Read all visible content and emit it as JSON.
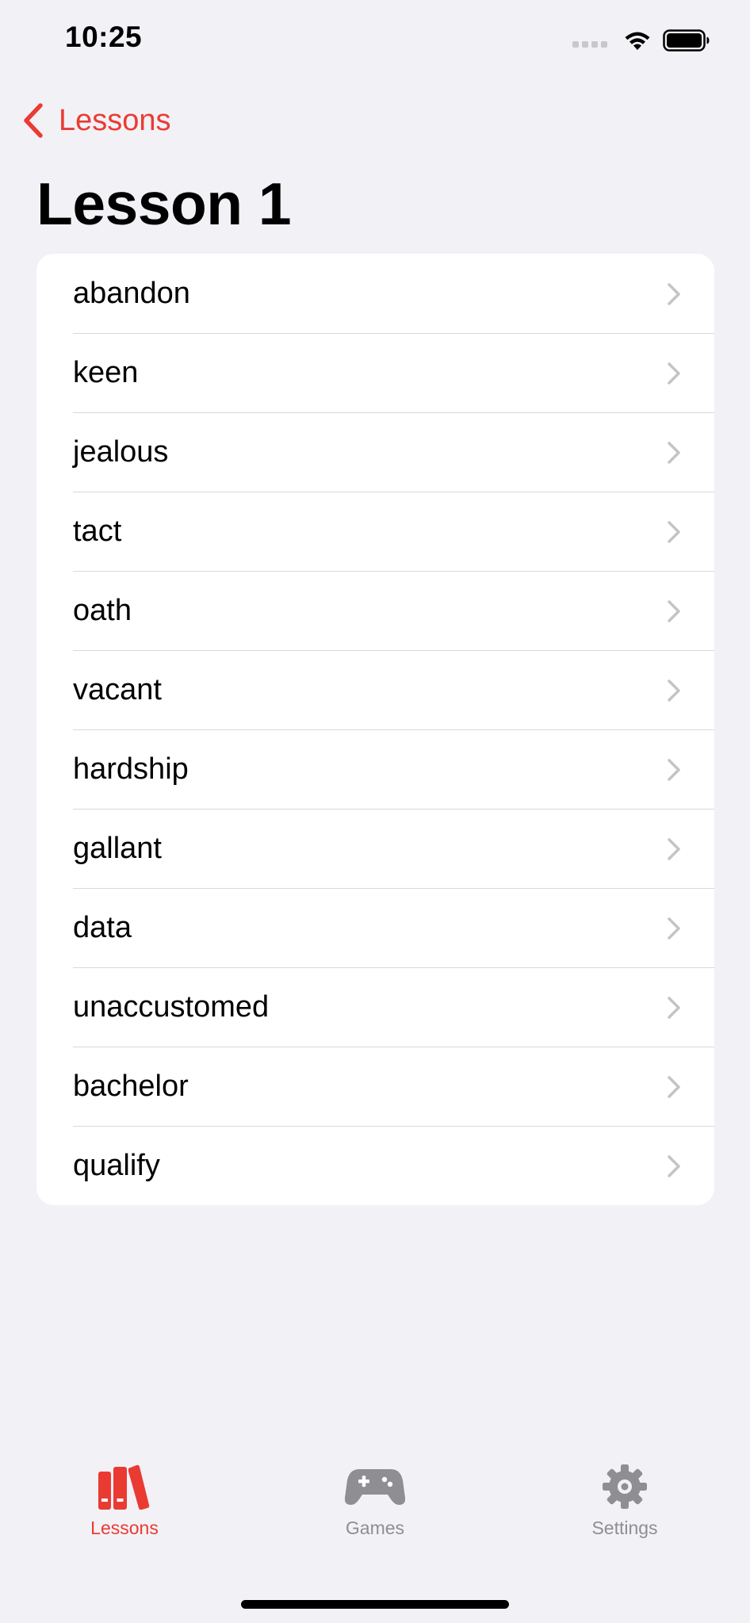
{
  "status_bar": {
    "time": "10:25",
    "signal_icon": "cellular-signal-icon",
    "wifi_icon": "wifi-icon",
    "battery_icon": "battery-full-icon"
  },
  "nav": {
    "back_label": "Lessons",
    "back_icon": "chevron-left-icon"
  },
  "page": {
    "title": "Lesson 1"
  },
  "words": [
    {
      "label": "abandon"
    },
    {
      "label": "keen"
    },
    {
      "label": "jealous"
    },
    {
      "label": "tact"
    },
    {
      "label": "oath"
    },
    {
      "label": "vacant"
    },
    {
      "label": "hardship"
    },
    {
      "label": "gallant"
    },
    {
      "label": "data"
    },
    {
      "label": "unaccustomed"
    },
    {
      "label": "bachelor"
    },
    {
      "label": "qualify"
    }
  ],
  "tab_bar": {
    "tabs": [
      {
        "label": "Lessons",
        "icon": "books-icon",
        "active": true
      },
      {
        "label": "Games",
        "icon": "gamecontroller-icon",
        "active": false
      },
      {
        "label": "Settings",
        "icon": "gear-icon",
        "active": false
      }
    ]
  },
  "colors": {
    "accent": "#ea3b33",
    "background": "#f2f1f6",
    "card": "#ffffff",
    "inactive_tab": "#8e8e93",
    "chevron": "#c4c4c7",
    "separator": "#d9d9dd"
  }
}
